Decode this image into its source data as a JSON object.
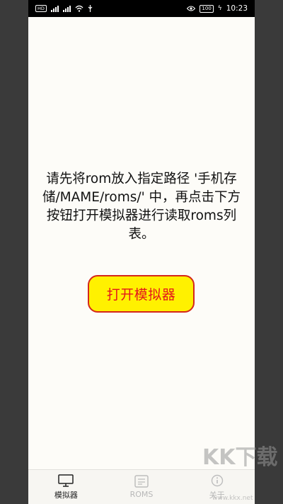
{
  "status_bar": {
    "hd_label": "HD",
    "battery": "100",
    "time": "10:23"
  },
  "main": {
    "message": "请先将rom放入指定路径 '手机存储/MAME/roms/' 中，再点击下方按钮打开模拟器进行读取roms列表。",
    "open_button_label": "打开模拟器"
  },
  "tabs": [
    {
      "label": "模拟器",
      "icon": "monitor-icon",
      "active": true
    },
    {
      "label": "ROMS",
      "icon": "rom-list-icon",
      "active": false
    },
    {
      "label": "关于",
      "icon": "info-icon",
      "active": false
    }
  ],
  "watermark": {
    "logo_text": "KK下载",
    "url": "www.kkx.net"
  },
  "colors": {
    "button_fill": "#fff100",
    "button_border": "#d4271b",
    "button_text": "#e4161c",
    "screen_bg": "#fdfcf8"
  }
}
